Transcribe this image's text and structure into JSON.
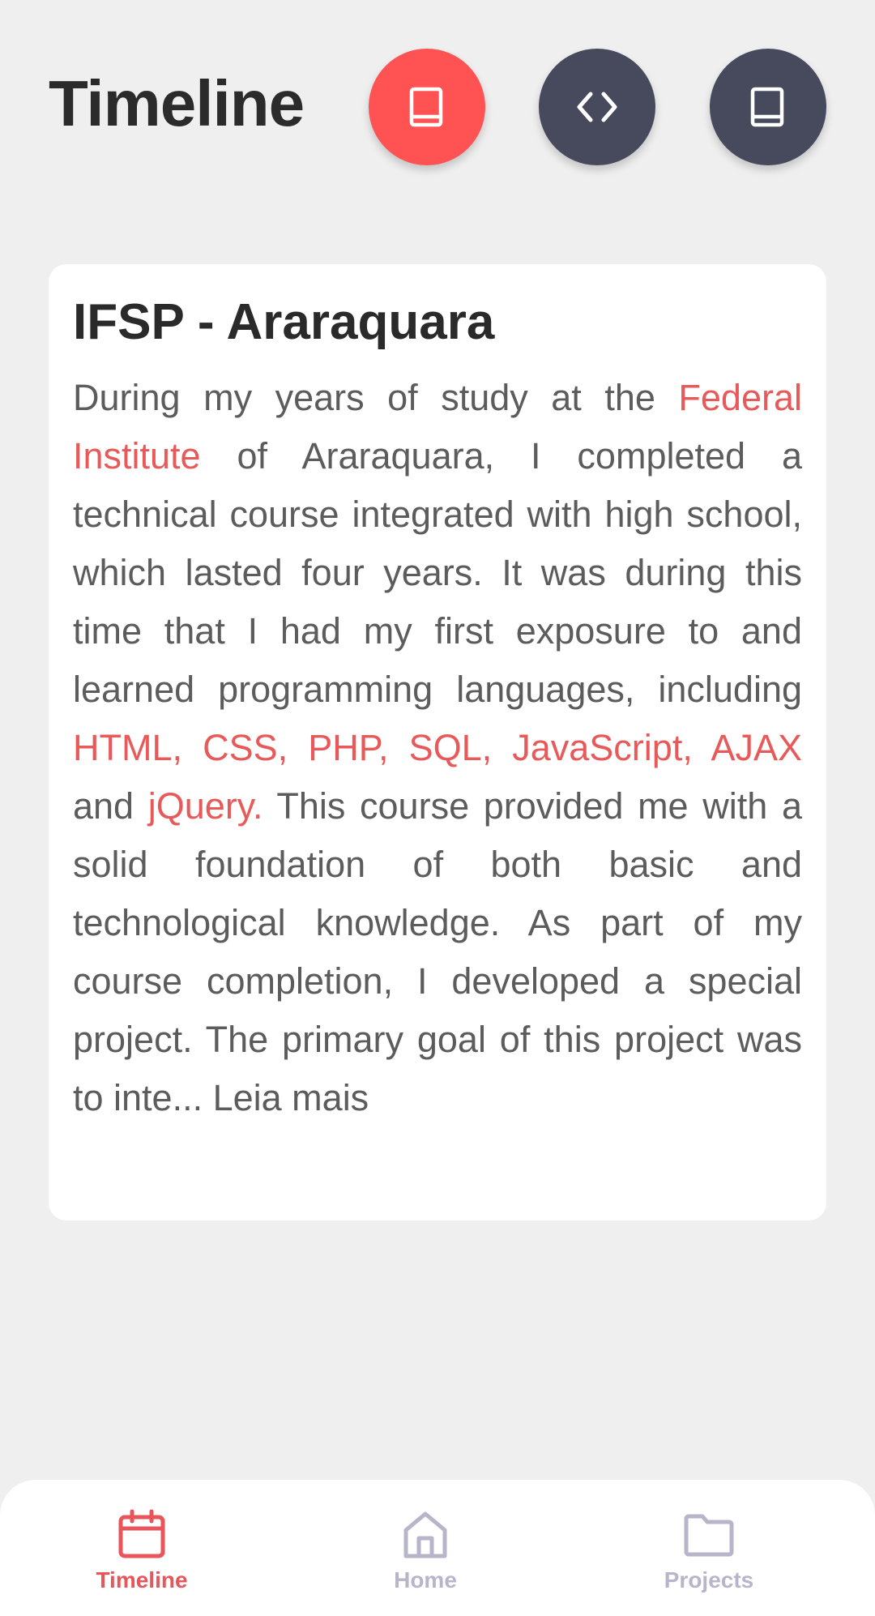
{
  "header": {
    "title": "Timeline",
    "buttons": [
      {
        "icon": "book-icon",
        "active": true
      },
      {
        "icon": "code-icon",
        "active": false
      },
      {
        "icon": "book-icon",
        "active": false
      }
    ]
  },
  "card": {
    "title": "IFSP - Araraquara",
    "body": {
      "p1": "During my years of study at the ",
      "h1": "Federal Institute",
      "p2": " of Araraquara, I completed a technical course integrated with high school, which lasted four years. It was during this time that I had my first exposure to and learned programming languages, including ",
      "h2": "HTML, CSS, PHP, SQL, JavaScript, AJAX",
      "p3": " and ",
      "h3": "jQuery.",
      "p4": " This course provided me with a solid foundation of both basic and technological knowledge. As part of my course completion, I developed a special project. The primary goal of this project was to inte...",
      "more": " Leia mais"
    }
  },
  "bottom_nav": {
    "items": [
      {
        "label": "Timeline",
        "icon": "calendar-icon",
        "active": true
      },
      {
        "label": "Home",
        "icon": "home-icon",
        "active": false
      },
      {
        "label": "Projects",
        "icon": "folder-icon",
        "active": false
      }
    ]
  },
  "colors": {
    "accent": "#ff5252",
    "dark_button": "#464a5c",
    "highlight_text": "#e85a5a",
    "inactive_nav": "#b7b5c9",
    "background": "#efefef"
  }
}
